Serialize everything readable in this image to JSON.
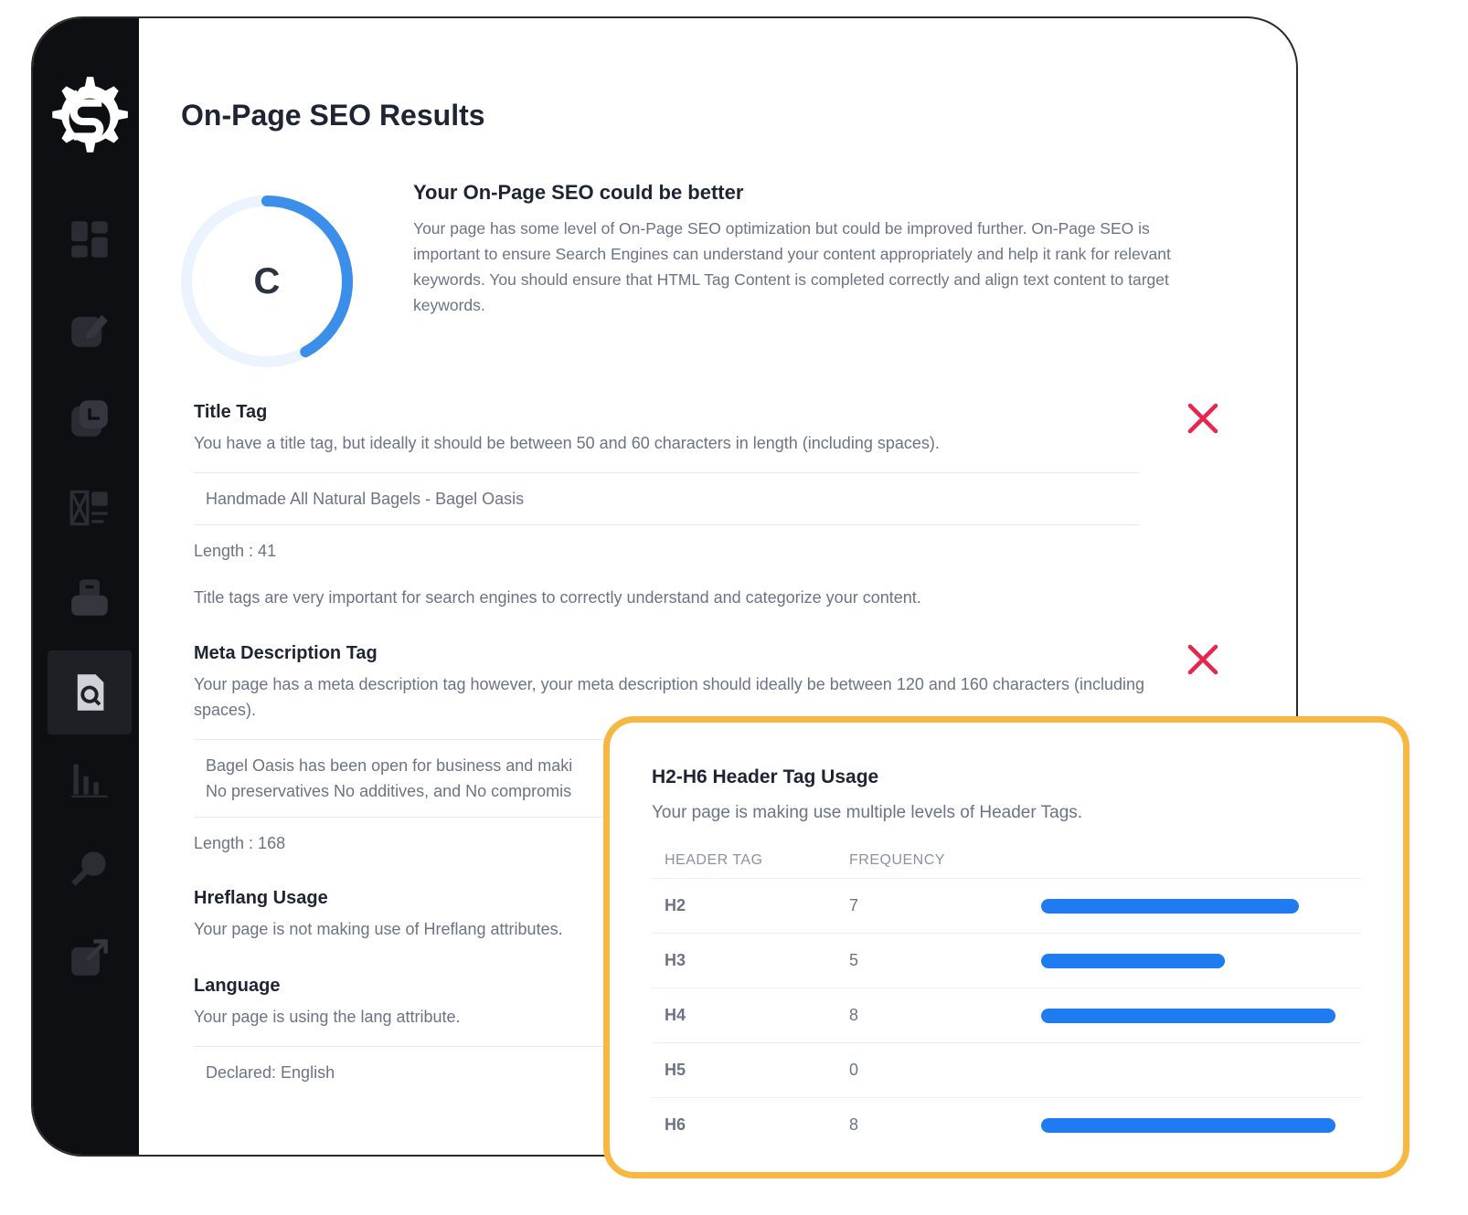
{
  "page": {
    "title": "On-Page SEO Results"
  },
  "score": {
    "grade": "C",
    "progress": 0.42,
    "track_color": "#ebf3ff",
    "arc_color": "#3b8eea"
  },
  "summary": {
    "heading": "Your On-Page SEO could be better",
    "text": "Your page has some level of On-Page SEO optimization but could be improved further. On-Page SEO is important to ensure Search Engines can understand your content appropriately and help it rank for relevant keywords. You should ensure that HTML Tag Content is completed correctly and align text content to target keywords."
  },
  "sidebar": {
    "items": [
      {
        "icon": "dashboard-icon"
      },
      {
        "icon": "edit-icon"
      },
      {
        "icon": "report-icon"
      },
      {
        "icon": "layout-icon"
      },
      {
        "icon": "inbox-icon"
      },
      {
        "icon": "seo-search-icon",
        "active": true
      },
      {
        "icon": "bar-chart-icon"
      },
      {
        "icon": "key-icon"
      },
      {
        "icon": "external-link-icon"
      }
    ]
  },
  "checks": {
    "title_tag": {
      "heading": "Title Tag",
      "desc": "You have a title tag, but ideally it should be between 50 and 60 characters in length (including spaces).",
      "value": "Handmade All Natural Bagels - Bagel Oasis",
      "length": "Length : 41",
      "note": "Title tags are very important for search engines to correctly understand and categorize your content.",
      "status": "fail"
    },
    "meta_description": {
      "heading": "Meta Description Tag",
      "desc": "Your page has a meta description tag however, your meta description should ideally be between 120 and 160 characters (including spaces).",
      "value_line1": "Bagel Oasis has been open for business and maki",
      "value_line2": "No preservatives No additives, and No compromis",
      "length": "Length : 168",
      "status": "fail"
    },
    "hreflang": {
      "heading": "Hreflang Usage",
      "desc": "Your page is not making use of Hreflang attributes."
    },
    "language": {
      "heading": "Language",
      "desc": "Your page is using the lang attribute.",
      "declared": "Declared: English"
    }
  },
  "status_color": "#e8254d",
  "header_tags": {
    "heading": "H2-H6 Header Tag Usage",
    "desc": "Your page is making use multiple levels of Header Tags.",
    "col_tag": "HEADER TAG",
    "col_freq": "FREQUENCY",
    "bar_color": "#1e7cf0",
    "max": 8,
    "rows": [
      {
        "tag": "H2",
        "freq": "7",
        "value": 7
      },
      {
        "tag": "H3",
        "freq": "5",
        "value": 5
      },
      {
        "tag": "H4",
        "freq": "8",
        "value": 8
      },
      {
        "tag": "H5",
        "freq": "0",
        "value": 0
      },
      {
        "tag": "H6",
        "freq": "8",
        "value": 8
      }
    ]
  }
}
